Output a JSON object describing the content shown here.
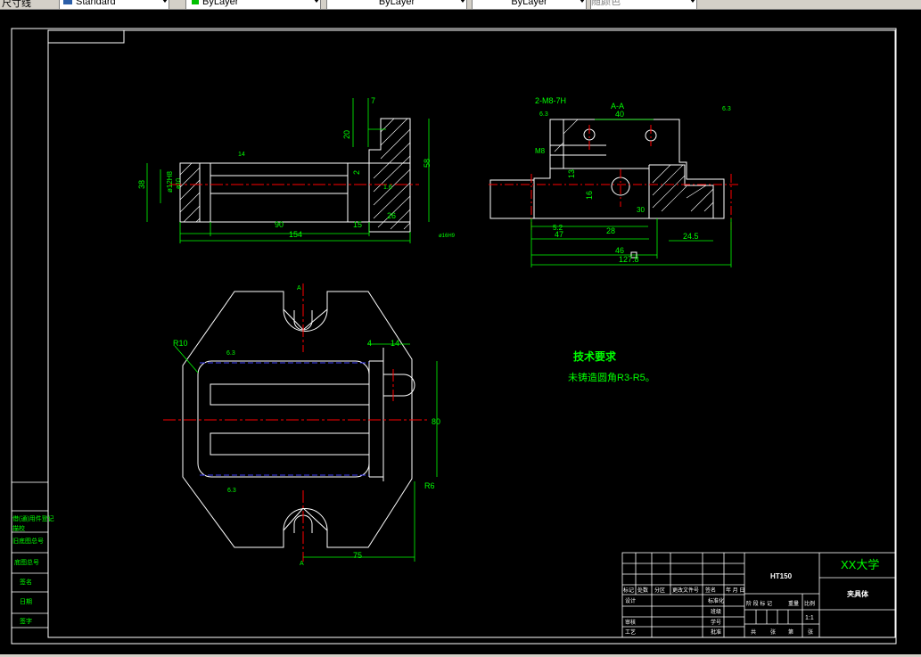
{
  "toolbar": {
    "linetype_label": "尺寸线",
    "style_value": "Standard",
    "layer_color_value": "ByLayer",
    "linetype_value": "ByLayer",
    "lineweight_value": "ByLayer",
    "plotstyle_value": "随颜色"
  },
  "colors": {
    "background": "#000000",
    "frame": "#ffffff",
    "dimension": "#00ff00",
    "centerline": "#ff0000",
    "hidden": "#0000ff",
    "title_text": "#00ff00"
  },
  "drawing": {
    "tech_req_title": "技术要求",
    "tech_req_text": "未铸造圆角R3-R5。",
    "section_label": "A-A",
    "cut_label_top": "A",
    "cut_label_bottom": "A",
    "dims_top": [
      "7",
      "20",
      "58",
      "38",
      "ø12H8",
      "ø10",
      "90",
      "154",
      "15",
      "26",
      "14",
      "1.6",
      "2",
      "ø16H9"
    ],
    "dims_right": [
      "2-M8-7H",
      "6.3",
      "40",
      "M8",
      "13",
      "16",
      "5.2",
      "47",
      "28",
      "46",
      "127.8",
      "24.5",
      "30",
      "6.3"
    ],
    "dims_bottom": [
      "R10",
      "4",
      "14",
      "6.3",
      "80",
      "R6",
      "75",
      "6.3"
    ],
    "title_block": {
      "material": "HT150",
      "school": "XX大学",
      "part_name": "夹具体",
      "scale": "1:1",
      "row_labels": [
        "标记",
        "处数",
        "分区",
        "更改文件号",
        "签名",
        "年 月 日"
      ],
      "left_labels": [
        "设计",
        "审核",
        "工艺"
      ],
      "mid_labels": [
        "标准化",
        "班级",
        "学号",
        "批准"
      ],
      "stage_labels": [
        "阶 段 标 记",
        "重量",
        "比例"
      ],
      "sheet_labels": [
        "共",
        "张",
        "第",
        "张"
      ]
    },
    "side_table": [
      "借(通)用件登记",
      "描校",
      "旧底图总号",
      "底图总号",
      "签名",
      "日期",
      "签字"
    ]
  }
}
